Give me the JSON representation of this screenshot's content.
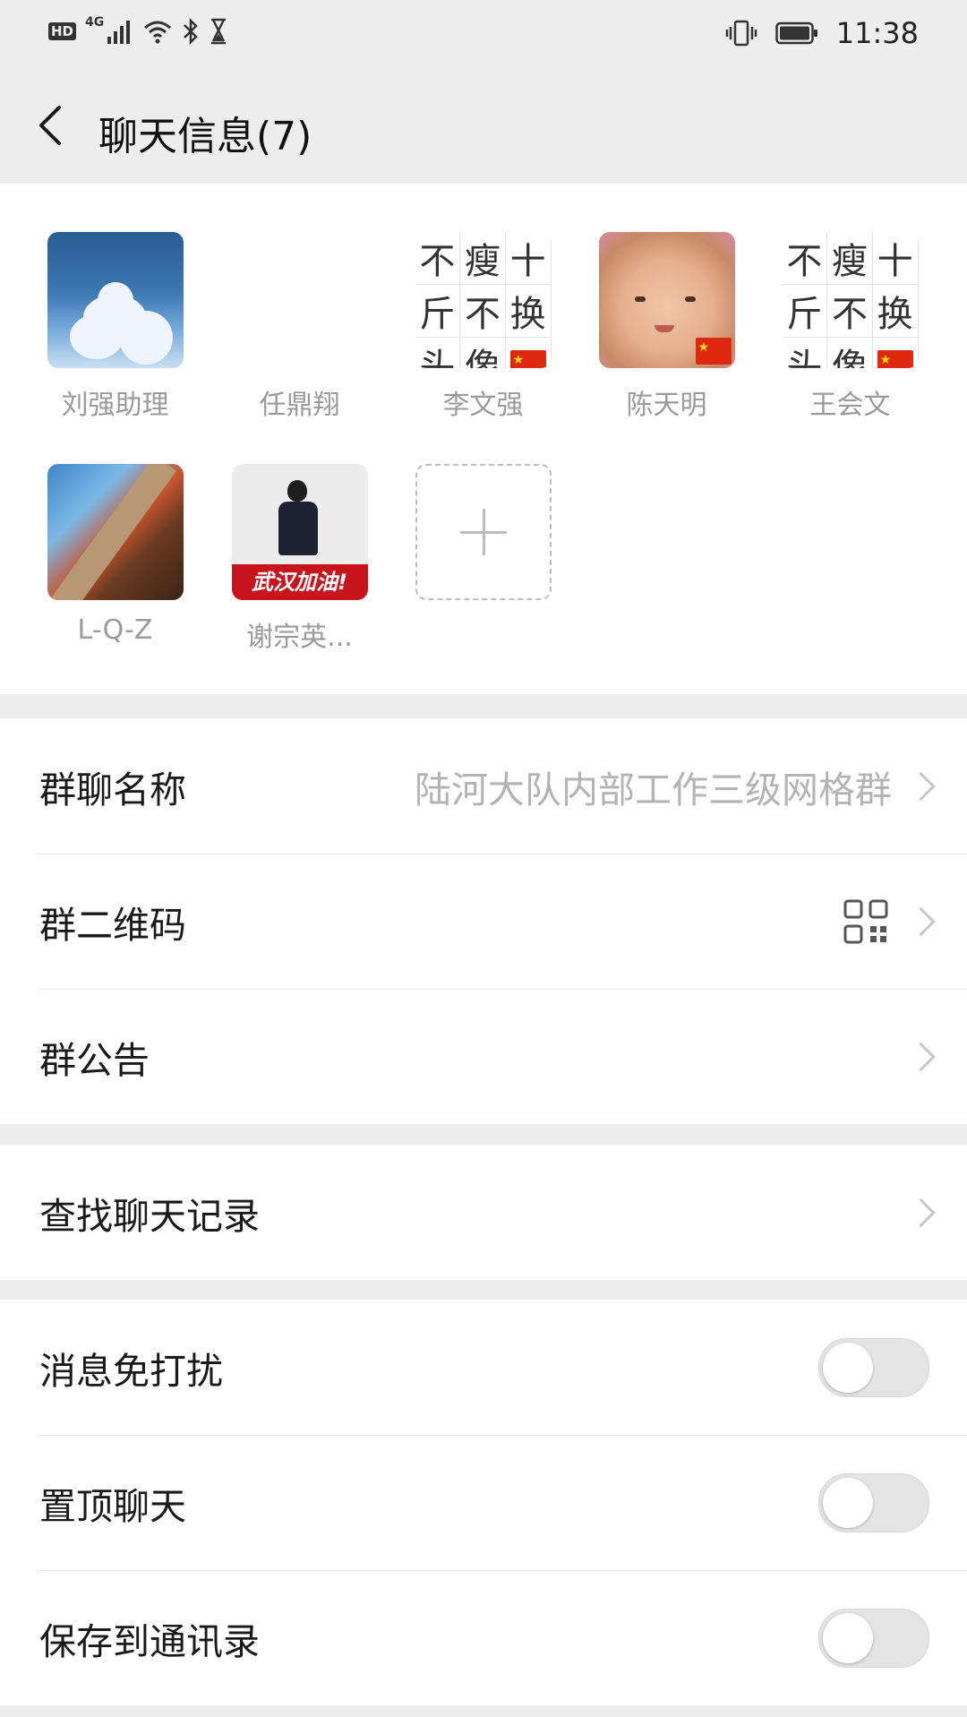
{
  "status_bar": {
    "hd_badge": "HD",
    "network": "4G",
    "time": "11:38"
  },
  "header": {
    "title": "聊天信息(7)"
  },
  "members": [
    {
      "name": "刘强助理",
      "avatar": "sky-clouds"
    },
    {
      "name": "任鼎翔",
      "avatar": "blank"
    },
    {
      "name": "李文强",
      "avatar": "text-grid",
      "grid_text": [
        "不",
        "瘦",
        "十",
        "斤",
        "不",
        "换",
        "头",
        "像"
      ]
    },
    {
      "name": "陈天明",
      "avatar": "baby-photo"
    },
    {
      "name": "王会文",
      "avatar": "text-grid",
      "grid_text": [
        "不",
        "瘦",
        "十",
        "斤",
        "不",
        "换",
        "头",
        "像"
      ]
    },
    {
      "name": "L-Q-Z",
      "avatar": "photo"
    },
    {
      "name": "谢宗英...",
      "avatar": "police-photo",
      "banner": "武汉加油!"
    }
  ],
  "add_member_icon": "plus-icon",
  "group_info": {
    "name_label": "群聊名称",
    "name_value": "陆河大队内部工作三级网格群",
    "qr_label": "群二维码",
    "notice_label": "群公告"
  },
  "search": {
    "label": "查找聊天记录"
  },
  "toggles": {
    "mute_label": "消息免打扰",
    "mute_on": false,
    "pin_label": "置顶聊天",
    "pin_on": false,
    "save_label": "保存到通讯录",
    "save_on": false
  },
  "colors": {
    "page_bg": "#ededed",
    "card_bg": "#ffffff",
    "secondary_text": "#9a9a9a",
    "toggle_off": "#e4e4e4",
    "flag_red": "#de2910"
  }
}
